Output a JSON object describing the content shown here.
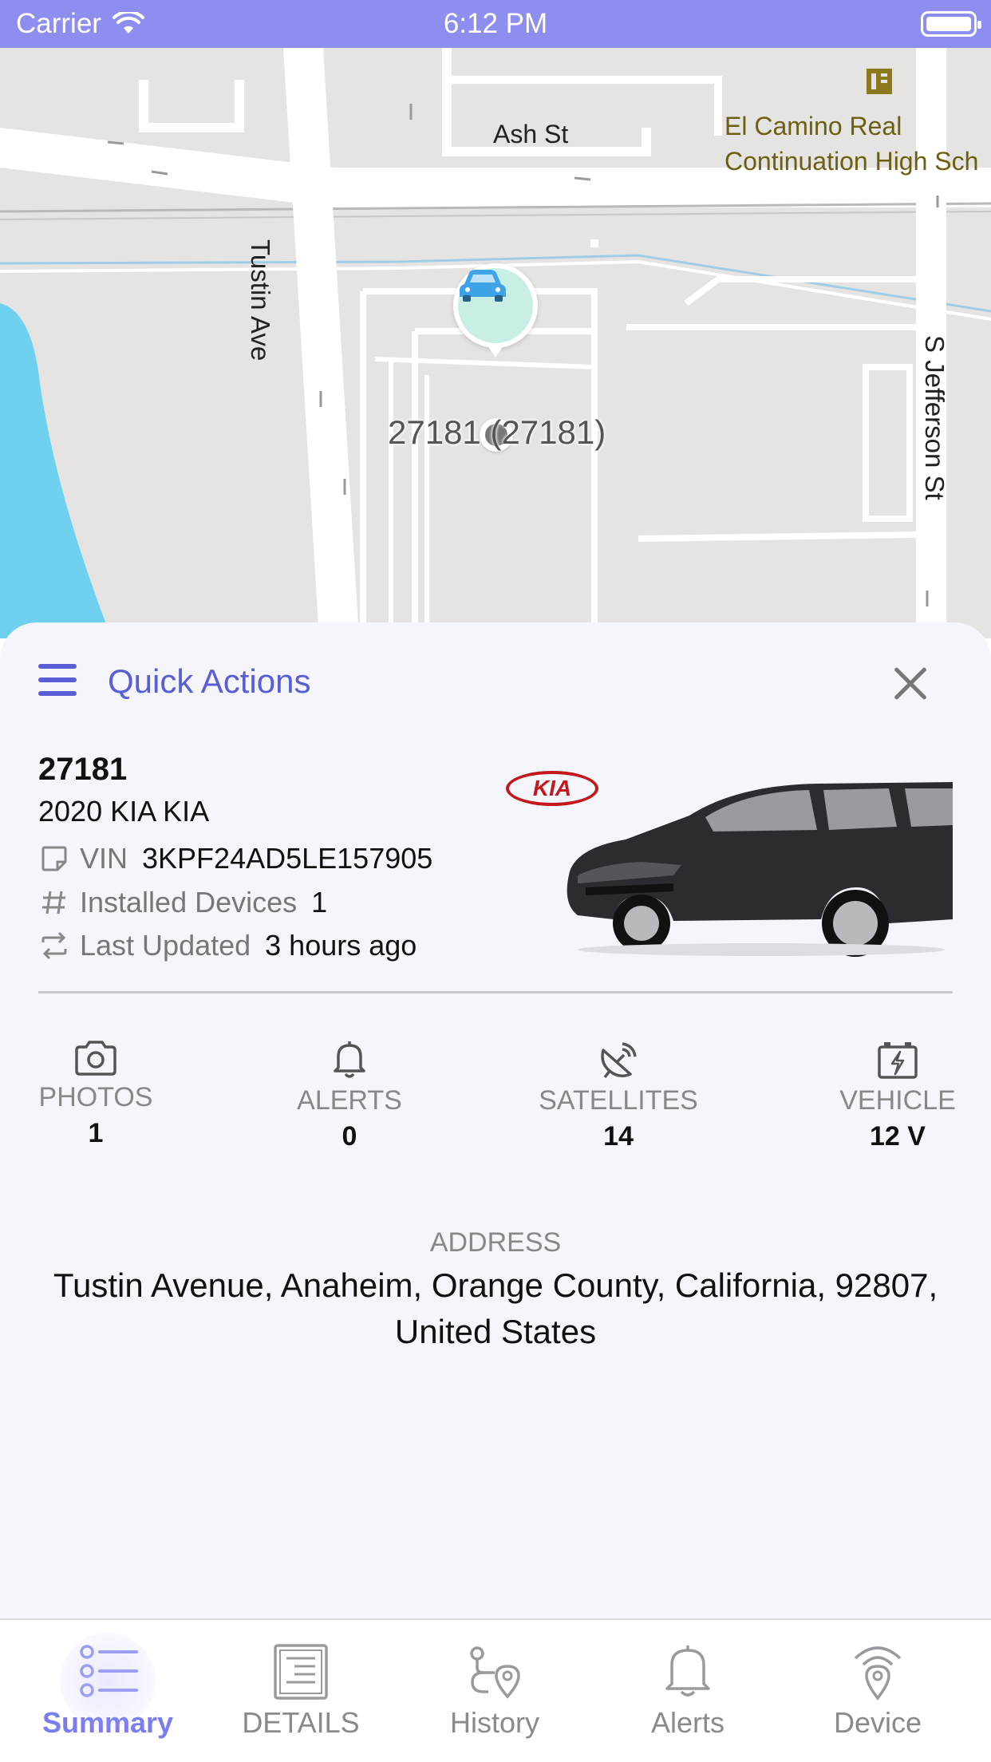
{
  "status_bar": {
    "carrier": "Carrier",
    "time": "6:12 PM"
  },
  "map": {
    "streets": [
      "Tustin Ave",
      "Ash St",
      "S Jefferson St"
    ],
    "poi": "El Camino Real\nContinuation High Sch",
    "marker_label": "27181 (27181)",
    "marker_icon": "car-icon"
  },
  "quick_actions": {
    "title": "Quick Actions"
  },
  "vehicle": {
    "id": "27181",
    "model": "2020 KIA KIA",
    "vin_label": "VIN",
    "vin": "3KPF24AD5LE157905",
    "devices_label": "Installed Devices",
    "devices": "1",
    "updated_label": "Last Updated",
    "updated": "3 hours ago",
    "brand": "KIA"
  },
  "stats": [
    {
      "label": "PHOTOS",
      "value": "1",
      "icon": "camera-icon"
    },
    {
      "label": "ALERTS",
      "value": "0",
      "icon": "bell-icon"
    },
    {
      "label": "SATELLITES",
      "value": "14",
      "icon": "satellite-icon"
    },
    {
      "label": "VEHICLE",
      "value": "12 V",
      "icon": "battery-icon"
    }
  ],
  "address": {
    "label": "ADDRESS",
    "text": "Tustin Avenue, Anaheim, Orange County, California, 92807, United States"
  },
  "tabs": [
    {
      "label": "Summary",
      "icon": "list-icon",
      "active": true
    },
    {
      "label": "DETAILS",
      "icon": "document-icon",
      "active": false
    },
    {
      "label": "History",
      "icon": "route-icon",
      "active": false
    },
    {
      "label": "Alerts",
      "icon": "bell-icon",
      "active": false
    },
    {
      "label": "Device",
      "icon": "location-signal-icon",
      "active": false
    }
  ],
  "colors": {
    "accent": "#5a5ed6",
    "status_bar": "#8d8ef0",
    "tab_active": "#7a7cf0",
    "map_water": "#6fd0ef"
  }
}
